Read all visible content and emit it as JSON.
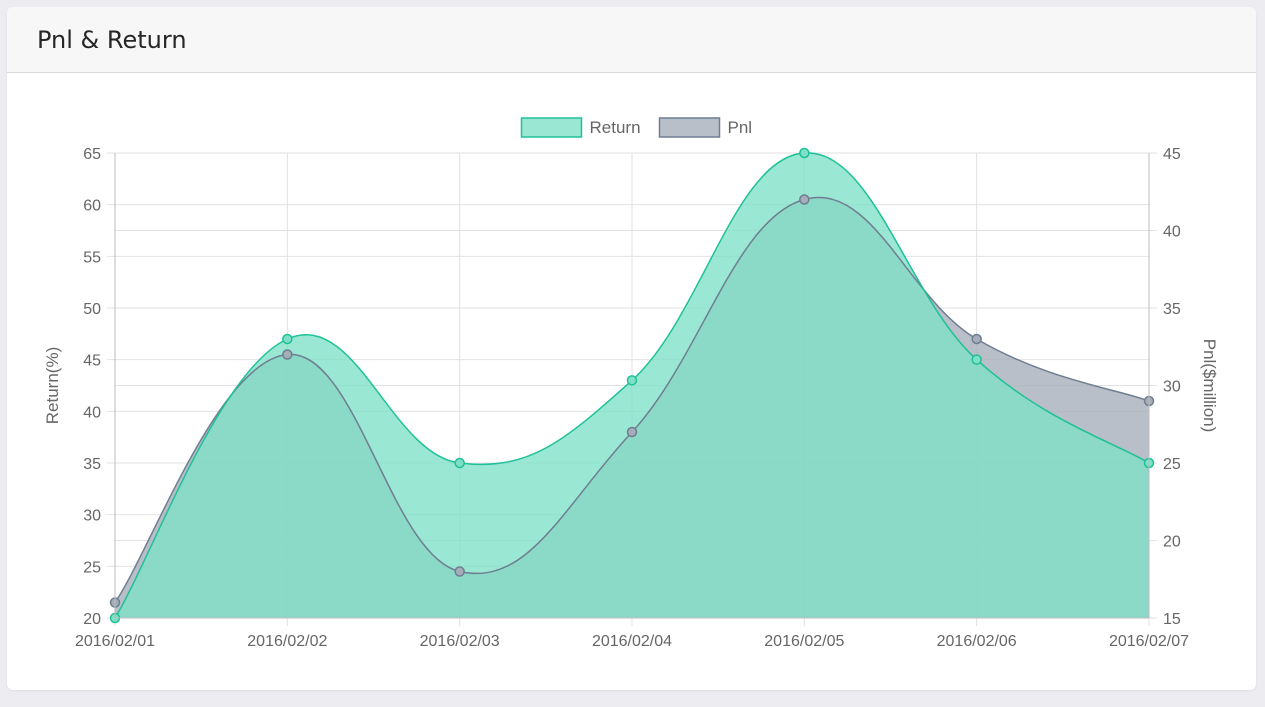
{
  "panel": {
    "title": "Pnl & Return"
  },
  "chart_data": {
    "type": "area",
    "categories": [
      "2016/02/01",
      "2016/02/02",
      "2016/02/03",
      "2016/02/04",
      "2016/02/05",
      "2016/02/06",
      "2016/02/07"
    ],
    "series": [
      {
        "name": "Return",
        "axis": "left",
        "values": [
          20,
          47,
          35,
          43,
          65,
          45,
          35
        ],
        "fill": "#7ee0c6",
        "stroke": "#1fc197"
      },
      {
        "name": "Pnl",
        "axis": "right",
        "values": [
          16,
          32,
          18,
          27,
          42,
          33,
          29
        ],
        "fill": "#a5adb8",
        "stroke": "#6f7e93"
      }
    ],
    "y_left": {
      "label": "Return(%)",
      "range": [
        20,
        65
      ],
      "ticks": [
        20,
        25,
        30,
        35,
        40,
        45,
        50,
        55,
        60,
        65
      ]
    },
    "y_right": {
      "label": "Pnl($million)",
      "range": [
        15,
        45
      ],
      "ticks": [
        15,
        20,
        25,
        30,
        35,
        40,
        45
      ]
    },
    "legend": "top-center",
    "grid": true,
    "smooth": true
  }
}
